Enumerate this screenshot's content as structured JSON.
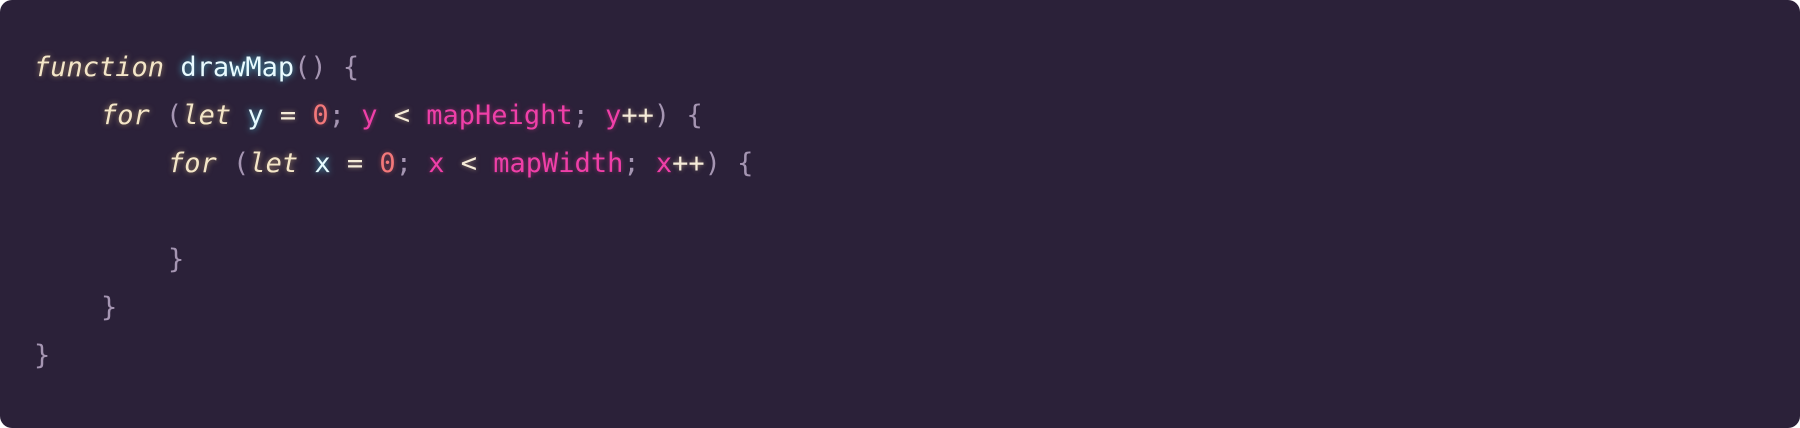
{
  "code": {
    "line1": {
      "kw": "function",
      "name": "drawMap",
      "parens": "()",
      "brace": "{"
    },
    "line2": {
      "kw_for": "for",
      "open_paren": "(",
      "kw_let": "let",
      "var": "y",
      "eq": "=",
      "init": "0",
      "semi1": ";",
      "cond_var": "y",
      "lt": "<",
      "limit": "mapHeight",
      "semi2": ";",
      "inc_var": "y",
      "inc_op": "++",
      "close_paren": ")",
      "brace": "{"
    },
    "line3": {
      "kw_for": "for",
      "open_paren": "(",
      "kw_let": "let",
      "var": "x",
      "eq": "=",
      "init": "0",
      "semi1": ";",
      "cond_var": "x",
      "lt": "<",
      "limit": "mapWidth",
      "semi2": ";",
      "inc_var": "x",
      "inc_op": "++",
      "close_paren": ")",
      "brace": "{"
    },
    "line5": {
      "brace": "}"
    },
    "line6": {
      "brace": "}"
    },
    "line7": {
      "brace": "}"
    }
  },
  "colors": {
    "background": "#2b2139",
    "keyword": "#f4e6c8",
    "function_name": "#e9fbff",
    "variable_pink": "#ef3fa8",
    "number": "#f3787a",
    "punctuation": "#a595b2"
  }
}
